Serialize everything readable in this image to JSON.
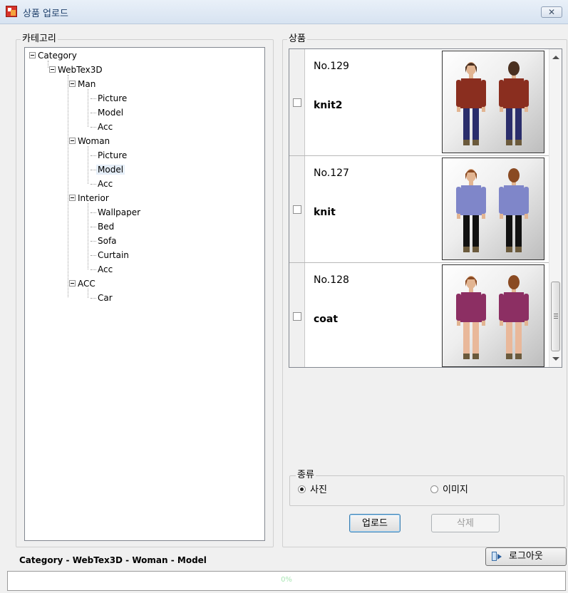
{
  "window": {
    "title": "상품 업로드",
    "close_label": "✕"
  },
  "category_panel": {
    "legend": "카테고리",
    "tree": {
      "root": "Category",
      "webtex": "WebTex3D",
      "man": "Man",
      "man_items": [
        "Picture",
        "Model",
        "Acc"
      ],
      "woman": "Woman",
      "woman_items": [
        "Picture",
        "Model",
        "Acc"
      ],
      "interior": "Interior",
      "interior_items": [
        "Wallpaper",
        "Bed",
        "Sofa",
        "Curtain",
        "Acc"
      ],
      "acc": "ACC",
      "acc_items": [
        "Car"
      ]
    }
  },
  "product_panel": {
    "legend": "상품",
    "products": [
      {
        "no": "No.129",
        "name": "knit2",
        "top_color": "#8a2e1f",
        "pants_color": "#2a2d6b",
        "hair_color": "#4a3020"
      },
      {
        "no": "No.127",
        "name": "knit",
        "top_color": "#7f86c9",
        "pants_color": "#111111",
        "hair_color": "#8a4a22"
      },
      {
        "no": "No.128",
        "name": "coat",
        "top_color": "#8c2f63",
        "pants_color": "#e9b89a",
        "hair_color": "#8a4a22"
      }
    ]
  },
  "kind": {
    "legend": "종류",
    "options": [
      "사진",
      "이미지"
    ],
    "selected": "사진"
  },
  "buttons": {
    "upload": "업로드",
    "delete": "삭제",
    "logout": "로그아웃"
  },
  "status": {
    "path": "Category - WebTex3D - Woman - Model"
  },
  "progress": {
    "label": "0%",
    "value": 0
  }
}
